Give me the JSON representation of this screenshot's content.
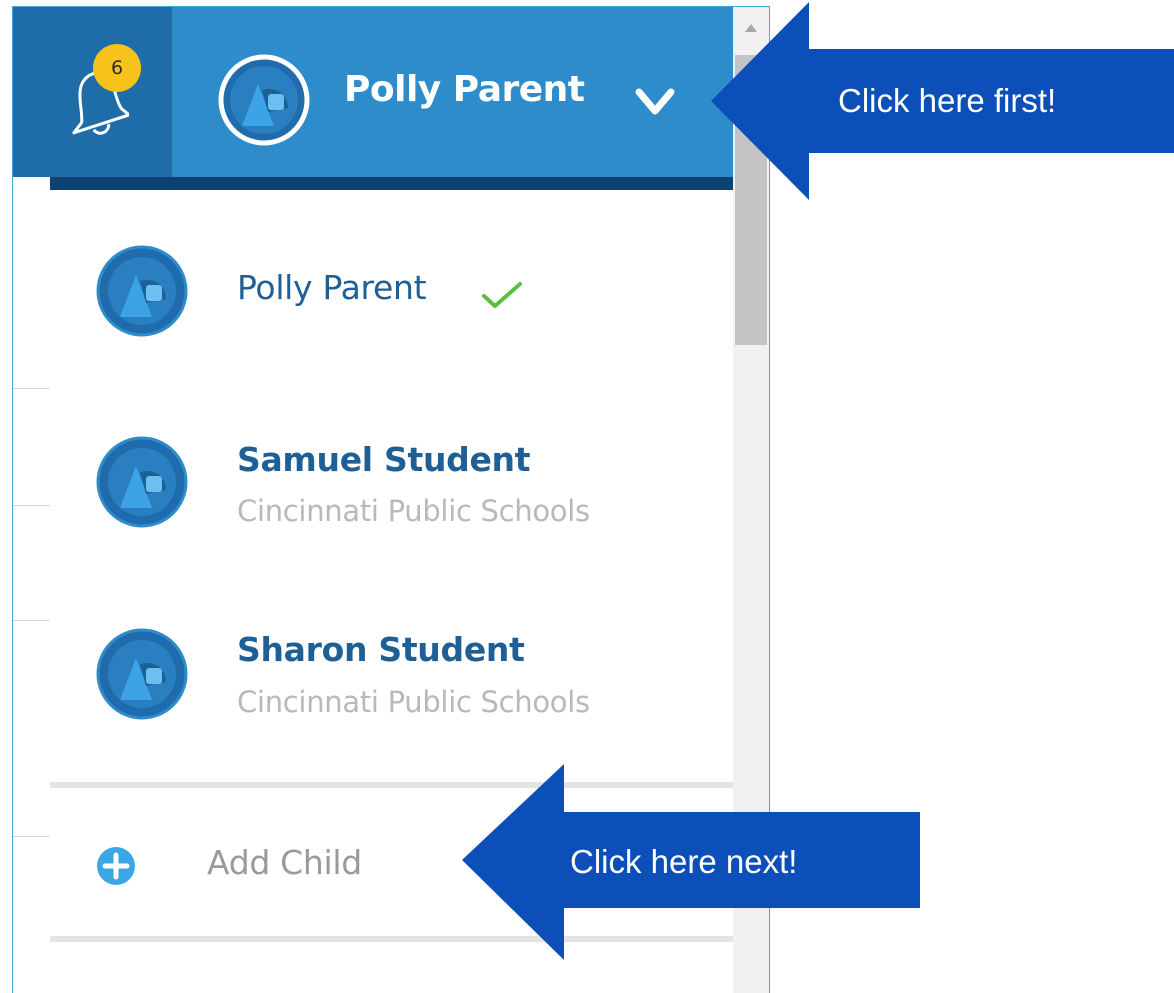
{
  "header": {
    "notification_count": "6",
    "current_user": "Polly Parent",
    "bell_icon": "bell-icon",
    "dropdown_icon": "chevron-down-icon",
    "colors": {
      "bell_bg": "#1e6da8",
      "header_bg": "#2f8ccb",
      "badge": "#f6c21b",
      "underline": "#0c4170"
    }
  },
  "dropdown": {
    "items": [
      {
        "name": "Polly Parent",
        "subtitle": "",
        "selected": true,
        "icon": "check-icon"
      },
      {
        "name": "Samuel Student",
        "subtitle": "Cincinnati Public Schools",
        "selected": false
      },
      {
        "name": "Sharon Student",
        "subtitle": "Cincinnati Public Schools",
        "selected": false
      }
    ],
    "add_child_label": "Add Child",
    "add_icon": "plus-circle-icon",
    "colors": {
      "name": "#1e5f95",
      "subtitle": "#b9b9b9",
      "check": "#5cbf3f",
      "plus": "#3aa6e6"
    }
  },
  "callouts": {
    "first": "Click here first!",
    "next": "Click here next!",
    "color": "#0d4fb8"
  }
}
